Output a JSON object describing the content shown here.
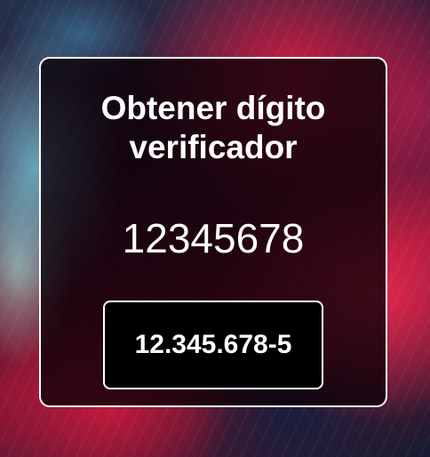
{
  "card": {
    "title": "Obtener dígito verificador",
    "input_number": "12345678",
    "result": "12.345.678-5"
  },
  "colors": {
    "card_background": "#0a0006",
    "border": "#ffffff",
    "text": "#ffffff",
    "result_background": "#000000"
  }
}
